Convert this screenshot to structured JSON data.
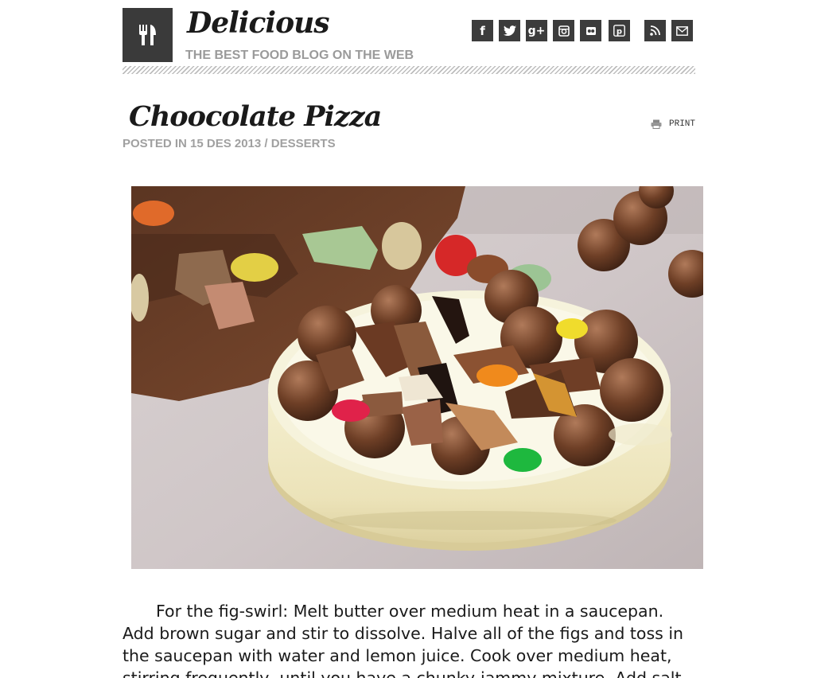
{
  "site": {
    "title": "Delicious",
    "tagline": "THE BEST FOOD BLOG ON THE WEB",
    "logo_icon": "fork-knife-icon"
  },
  "social": [
    {
      "name": "facebook-icon",
      "glyph": "f"
    },
    {
      "name": "twitter-icon",
      "glyph": ""
    },
    {
      "name": "google-plus-icon",
      "glyph": "g+"
    },
    {
      "name": "instagram-icon",
      "glyph": ""
    },
    {
      "name": "flickr-icon",
      "glyph": ""
    },
    {
      "name": "pinterest-icon",
      "glyph": ""
    },
    {
      "name": "rss-icon",
      "glyph": ""
    },
    {
      "name": "email-icon",
      "glyph": ""
    }
  ],
  "post": {
    "title": "Choocolate Pizza",
    "meta_prefix": "POSTED IN 15 DES 2013 / ",
    "category": "DESSERTS",
    "print_label": "PRINT",
    "body": "For the fig-swirl: Melt butter over medium heat in a saucepan. Add brown sugar and stir to dissolve. Halve all of the figs and toss in the saucepan with water and lemon juice. Cook over medium heat, stirring frequently, until you have a chunky-jammy mixture. Add salt with one"
  },
  "colors": {
    "social_bg": "#3c3c3c",
    "logo_bg": "#3a3a3a",
    "meta_gray": "#a0a0a0"
  }
}
